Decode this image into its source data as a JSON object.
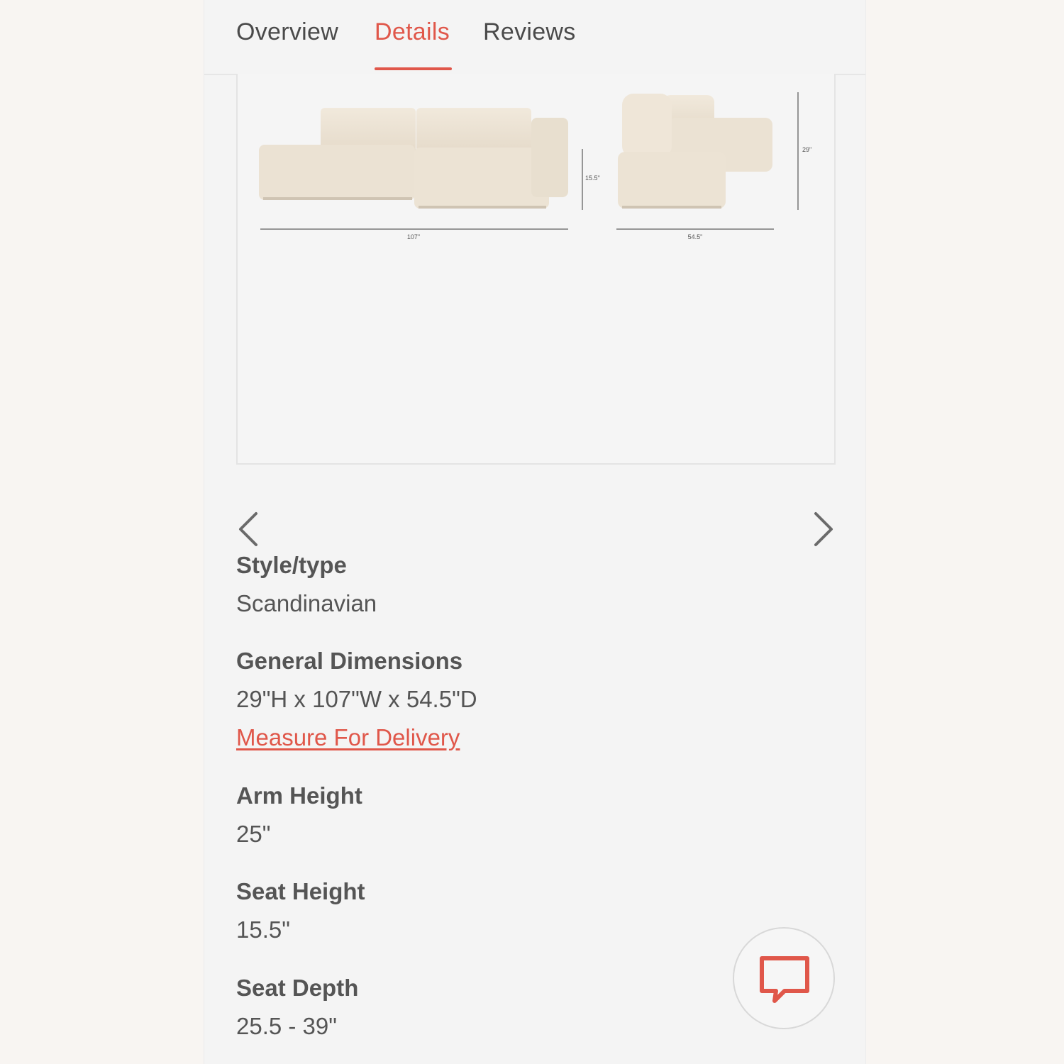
{
  "tabs": [
    {
      "label": "Overview",
      "active": false
    },
    {
      "label": "Details",
      "active": true
    },
    {
      "label": "Reviews",
      "active": false
    }
  ],
  "dimension_image": {
    "labels": {
      "width": "107\"",
      "seat_height": "15.5\"",
      "depth": "54.5\"",
      "height": "29\""
    }
  },
  "carousel": {
    "prev_icon": "chevron-left-icon",
    "next_icon": "chevron-right-icon"
  },
  "specs": {
    "style": {
      "label": "Style/type",
      "value": "Scandinavian"
    },
    "general": {
      "label": "General Dimensions",
      "value": "29\"H x 107\"W x 54.5\"D",
      "link": "Measure For Delivery"
    },
    "arm_height": {
      "label": "Arm Height",
      "value": "25\""
    },
    "seat_height": {
      "label": "Seat Height",
      "value": "15.5\""
    },
    "seat_depth": {
      "label": "Seat Depth",
      "value": "25.5 - 39\""
    }
  },
  "chat": {
    "icon": "chat-bubble-icon"
  },
  "colors": {
    "accent": "#e0574a",
    "text": "#555555",
    "panel": "#f4f4f4",
    "sofa": "#ede4d6"
  }
}
